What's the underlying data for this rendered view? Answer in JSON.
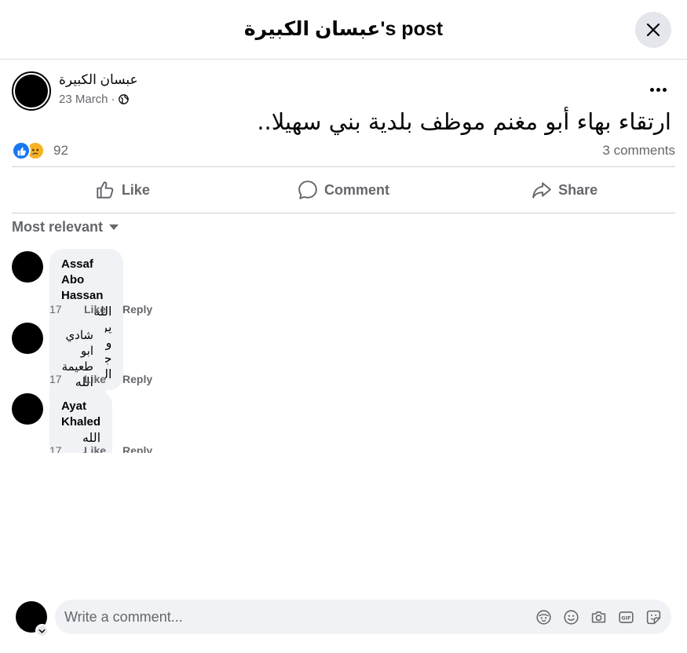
{
  "header": {
    "title": "عبسان الكبيرة's post"
  },
  "post": {
    "author": "عبسان الكبيرة",
    "date": "23 March",
    "separator": "·",
    "text": "ارتقاء بهاء أبو مغنم موظف بلدية بني سهيلا..",
    "reaction_count": "92",
    "comments_count": "3 comments"
  },
  "actions": {
    "like": "Like",
    "comment": "Comment",
    "share": "Share"
  },
  "sort": {
    "label": "Most relevant"
  },
  "comments": [
    {
      "name": "Assaf Abo Hassan",
      "text": "الله يرحمه ويرحم جميع المسلمين",
      "time": "17",
      "like": "Like",
      "reply": "Reply"
    },
    {
      "name": "شادي ابو طعيمة",
      "text": "الله يرحمه",
      "time": "17",
      "like": "Like",
      "reply": "Reply"
    },
    {
      "name": "Ayat Khaled",
      "text": "الله يرحمه",
      "time": "17",
      "like": "Like",
      "reply": "Reply"
    }
  ],
  "composer": {
    "placeholder": "Write a comment..."
  },
  "icons": [
    "close-icon",
    "more-icon",
    "globe-icon",
    "like-reaction-icon",
    "sad-reaction-icon",
    "like-icon",
    "comment-icon",
    "share-icon",
    "caret-down-icon",
    "chevron-down-icon",
    "avatar-sticker-icon",
    "emoji-icon",
    "camera-icon",
    "gif-icon",
    "sticker-icon"
  ],
  "colors": {
    "accent": "#1877f2",
    "secondary_text": "#65676b",
    "bubble": "#f0f2f5",
    "sad": "#f7b125"
  }
}
